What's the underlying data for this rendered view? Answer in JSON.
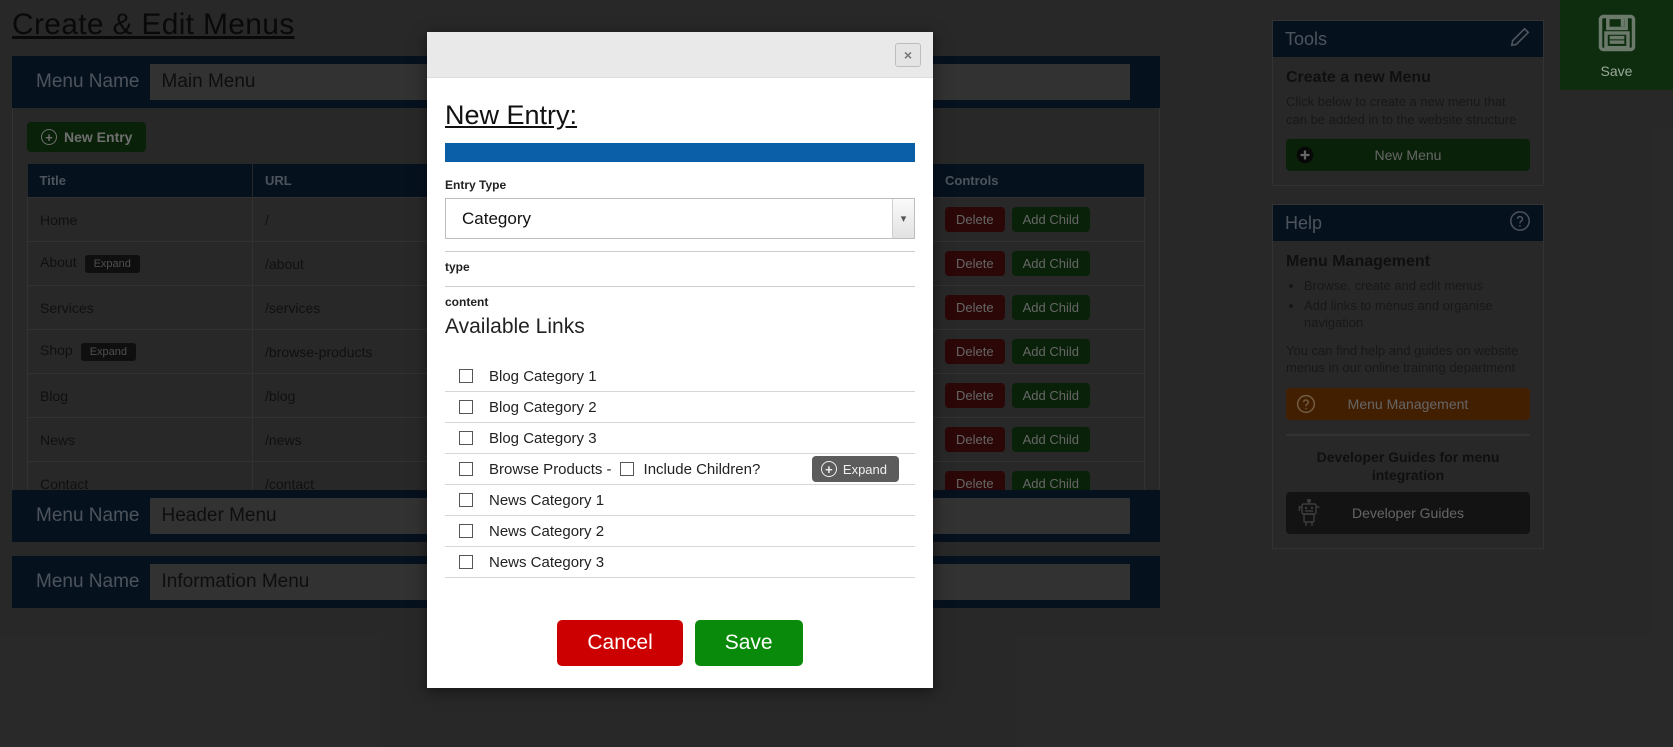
{
  "page": {
    "title": "Create & Edit Menus"
  },
  "top_save": {
    "label": "Save",
    "icon": "floppy-disk-icon"
  },
  "menus": [
    {
      "name_label": "Menu Name",
      "name_value": "Main Menu",
      "new_entry_label": "New Entry",
      "columns": [
        "Title",
        "URL",
        "Controls"
      ],
      "rows": [
        {
          "title": "Home",
          "expand": "",
          "url": "/",
          "delete": "Delete",
          "add_child": "Add Child"
        },
        {
          "title": "About",
          "expand": "Expand",
          "url": "/about",
          "delete": "Delete",
          "add_child": "Add Child"
        },
        {
          "title": "Services",
          "expand": "",
          "url": "/services",
          "delete": "Delete",
          "add_child": "Add Child"
        },
        {
          "title": "Shop",
          "expand": "Expand",
          "url": "/browse-products",
          "delete": "Delete",
          "add_child": "Add Child"
        },
        {
          "title": "Blog",
          "expand": "",
          "url": "/blog",
          "delete": "Delete",
          "add_child": "Add Child"
        },
        {
          "title": "News",
          "expand": "",
          "url": "/news",
          "delete": "Delete",
          "add_child": "Add Child"
        },
        {
          "title": "Contact",
          "expand": "",
          "url": "/contact",
          "delete": "Delete",
          "add_child": "Add Child"
        }
      ]
    },
    {
      "name_label": "Menu Name",
      "name_value": "Header Menu"
    },
    {
      "name_label": "Menu Name",
      "name_value": "Information Menu"
    }
  ],
  "sidebar": {
    "tools": {
      "title": "Tools",
      "icon": "pencil-icon",
      "heading": "Create a new Menu",
      "description": "Click below to create a new menu that can be added in to the website structure",
      "button_label": "New Menu",
      "button_icon": "plus-circle-icon"
    },
    "help": {
      "title": "Help",
      "icon": "question-circle-icon",
      "heading": "Menu Management",
      "bullets": [
        "Browse, create and edit menus",
        "Add links to menus and organise navigation"
      ],
      "description": "You can find help and guides on website menus in our online training department",
      "button_label": "Menu Management",
      "button_icon": "question-circle-icon",
      "dev_heading": "Developer Guides for menu integration",
      "dev_button_label": "Developer Guides",
      "dev_button_icon": "robot-icon"
    }
  },
  "modal": {
    "close_label": "×",
    "title": "New Entry:",
    "entry_type_label": "Entry Type",
    "entry_type_value": "Category",
    "type_label": "type",
    "content_label": "content",
    "available_links_title": "Available Links",
    "links": [
      {
        "label": "Blog Category 1",
        "inline_label": "",
        "expand": ""
      },
      {
        "label": "Blog Category 2",
        "inline_label": "",
        "expand": ""
      },
      {
        "label": "Blog Category 3",
        "inline_label": "",
        "expand": ""
      },
      {
        "label": "Browse Products -",
        "inline_label": "Include Children?",
        "expand": "Expand"
      },
      {
        "label": "News Category 1",
        "inline_label": "",
        "expand": ""
      },
      {
        "label": "News Category 2",
        "inline_label": "",
        "expand": ""
      },
      {
        "label": "News Category 3",
        "inline_label": "",
        "expand": ""
      }
    ],
    "cancel_label": "Cancel",
    "save_label": "Save"
  },
  "colors": {
    "navy": "#0b1f38",
    "page_bg": "#4a4a4a",
    "green": "#123d12",
    "dark_red": "#4f0d0d",
    "accent_blue": "#0a5fa8",
    "orange": "#7a3a04",
    "cancel_red": "#cc0000",
    "save_green": "#0a8a0a"
  }
}
